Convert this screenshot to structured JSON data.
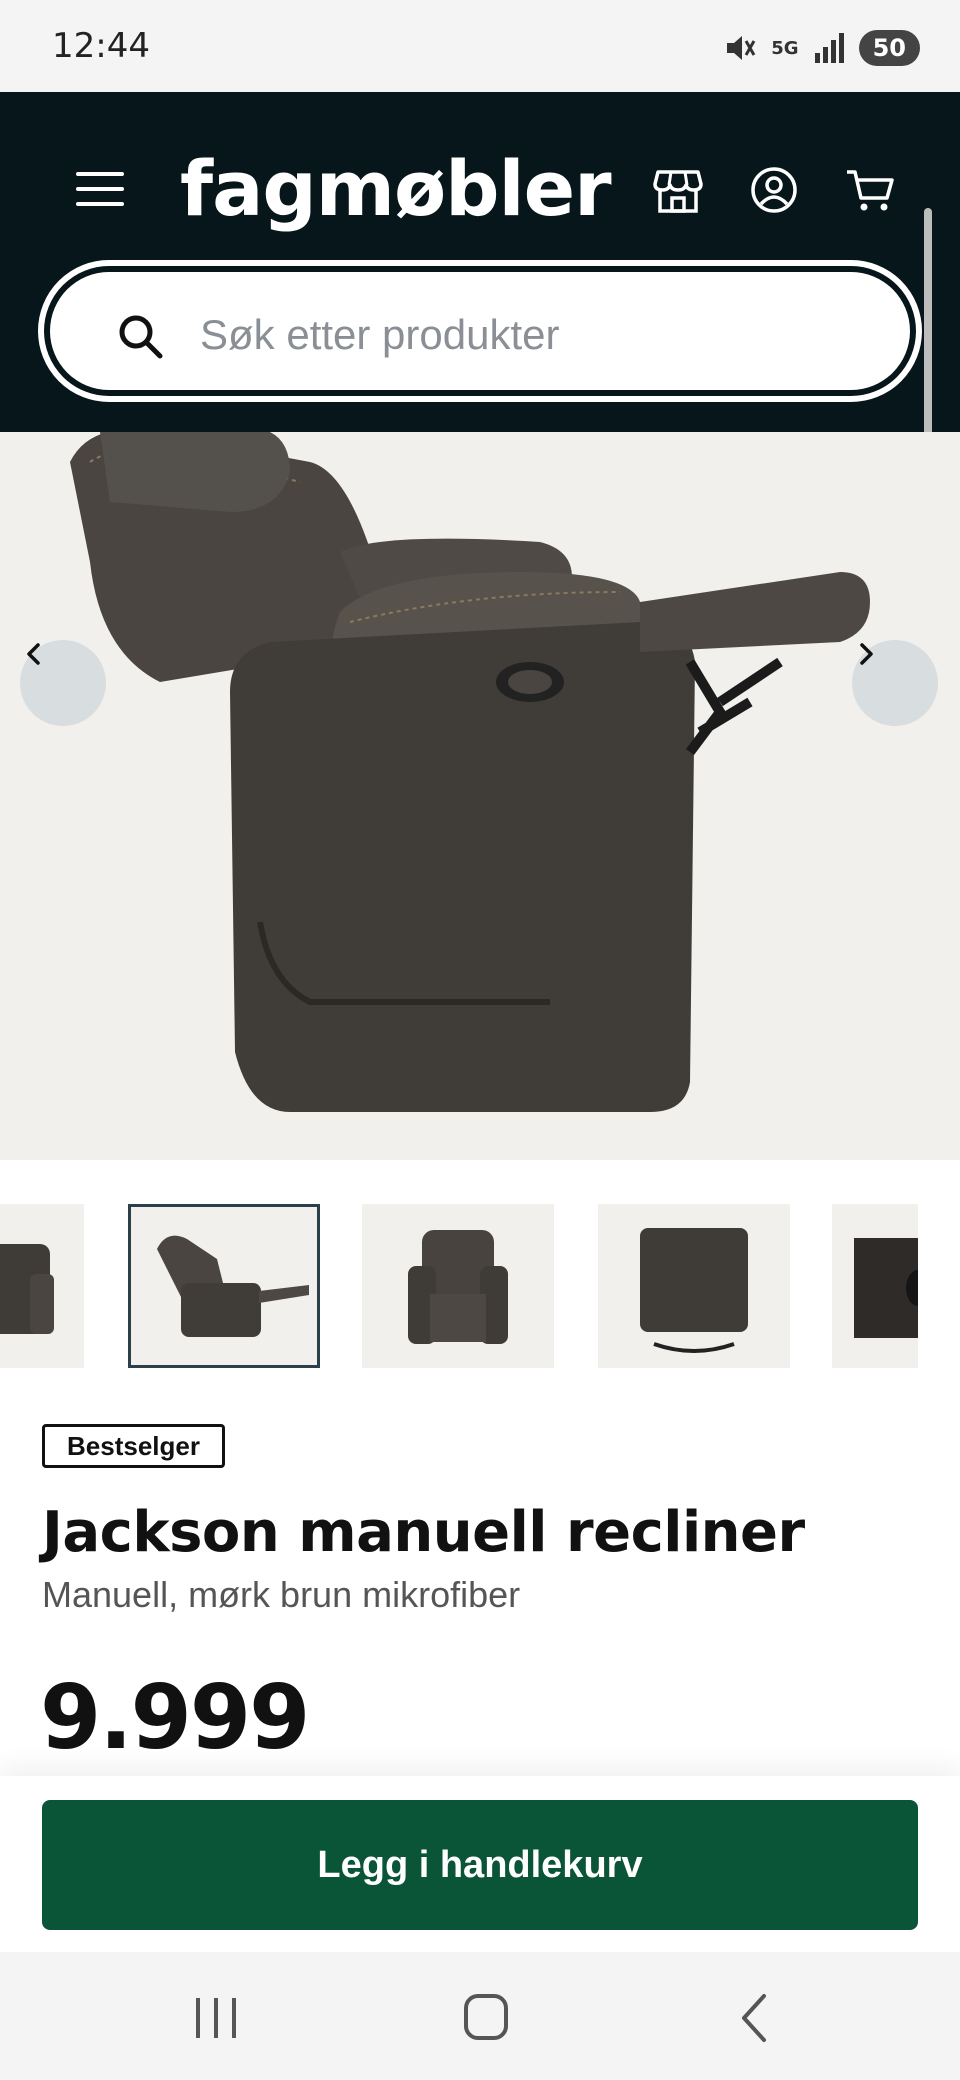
{
  "status_bar": {
    "time": "12:44",
    "network": "5G",
    "battery": "50"
  },
  "header": {
    "logo": "fagmøbler",
    "icons": [
      "menu-icon",
      "store-icon",
      "account-icon",
      "cart-icon"
    ]
  },
  "search": {
    "placeholder": "Søk etter produkter",
    "value": ""
  },
  "gallery": {
    "thumbnail_count": 5,
    "active_thumbnail": 2
  },
  "product": {
    "badge": "Bestselger",
    "title": "Jackson manuell recliner",
    "subtitle": "Manuell, mørk brun mikrofiber",
    "price": "9.999"
  },
  "cta": {
    "label": "Legg i handlekurv"
  },
  "colors": {
    "header_bg": "#07161a",
    "cta_bg": "#0a5537",
    "hero_bg": "#f1f0ed"
  }
}
